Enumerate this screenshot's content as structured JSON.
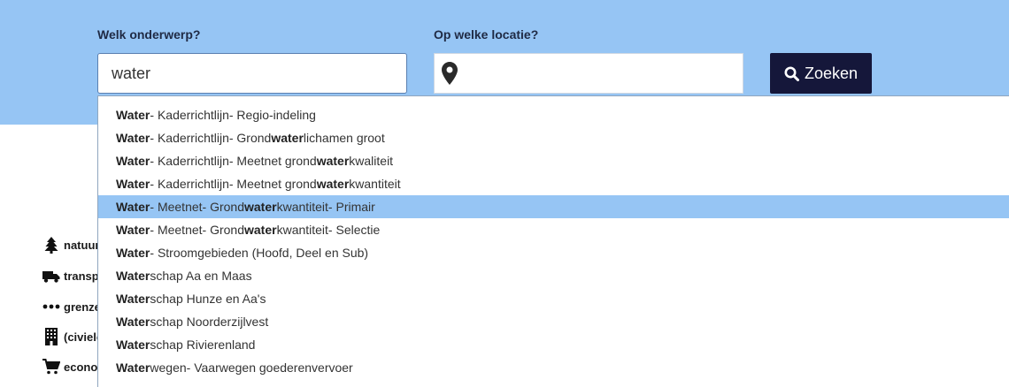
{
  "search": {
    "topic_label": "Welk onderwerp?",
    "topic_value": "water",
    "location_label": "Op welke locatie?",
    "location_value": "",
    "button_label": "Zoeken"
  },
  "categories": [
    {
      "label": "natuur",
      "icon": "tree-icon"
    },
    {
      "label": "transp",
      "icon": "truck-icon"
    },
    {
      "label": "grenze",
      "icon": "ellipsis-icon"
    },
    {
      "label": "(civiele",
      "icon": "building-icon"
    },
    {
      "label": "econor",
      "icon": "cart-icon"
    }
  ],
  "suggestions": {
    "highlighted_index": 4,
    "items": [
      {
        "parts": [
          "Water",
          "- Kaderrichtlijn- Regio-indeling"
        ]
      },
      {
        "parts": [
          "Water",
          "- Kaderrichtlijn- Grond",
          "water",
          "lichamen groot"
        ]
      },
      {
        "parts": [
          "Water",
          "- Kaderrichtlijn- Meetnet grond",
          "water",
          "kwaliteit"
        ]
      },
      {
        "parts": [
          "Water",
          "- Kaderrichtlijn- Meetnet grond",
          "water",
          "kwantiteit"
        ]
      },
      {
        "parts": [
          "Water",
          "- Meetnet- Grond",
          "water",
          "kwantiteit- Primair"
        ]
      },
      {
        "parts": [
          "Water",
          "- Meetnet- Grond",
          "water",
          "kwantiteit- Selectie"
        ]
      },
      {
        "parts": [
          "Water",
          "- Stroomgebieden (Hoofd, Deel en Sub)"
        ]
      },
      {
        "parts": [
          "Water",
          "schap Aa en Maas"
        ]
      },
      {
        "parts": [
          "Water",
          "schap Hunze en Aa's"
        ]
      },
      {
        "parts": [
          "Water",
          "schap Noorderzijlvest"
        ]
      },
      {
        "parts": [
          "Water",
          "schap Rivierenland"
        ]
      },
      {
        "parts": [
          "Water",
          "wegen- Vaarwegen goederenvervoer"
        ]
      }
    ]
  }
}
